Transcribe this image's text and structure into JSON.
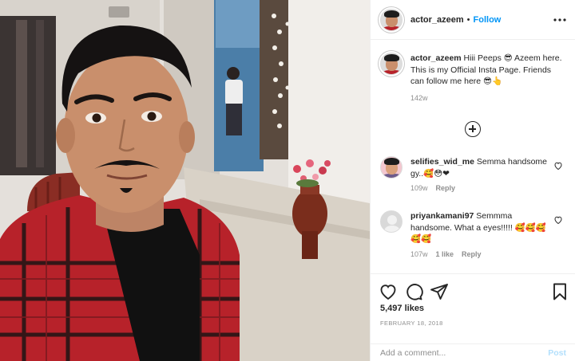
{
  "header": {
    "username": "actor_azeem",
    "separator": "•",
    "follow_label": "Follow",
    "more_label": "•••"
  },
  "caption": {
    "username": "actor_azeem",
    "text": " Hiii Peeps 😎 Azeem here. This is my Official Insta Page. Friends can follow me here 😎👆",
    "time": "142w"
  },
  "comments": [
    {
      "username": "selifies_wid_me",
      "text": " Semma handsome gy..🥰😳❤",
      "time": "109w",
      "likes": "",
      "reply_label": "Reply"
    },
    {
      "username": "priyankamani97",
      "text": " Semmma handsome. What a eyes!!!!! 🥰🥰🥰🥰🥰",
      "time": "107w",
      "likes": "1 like",
      "reply_label": "Reply"
    }
  ],
  "stats": {
    "likes": "5,497 likes",
    "date": "FEBRUARY 18, 2018"
  },
  "add_comment": {
    "placeholder": "Add a comment...",
    "post_label": "Post"
  },
  "colors": {
    "follow": "#0095f6",
    "post_disabled": "#b2dffc",
    "muted": "#8e8e8e",
    "shirt": "#b7222a"
  },
  "icons": [
    "heart-icon",
    "comment-icon",
    "share-icon",
    "bookmark-icon",
    "load-more-icon",
    "more-options-icon"
  ]
}
